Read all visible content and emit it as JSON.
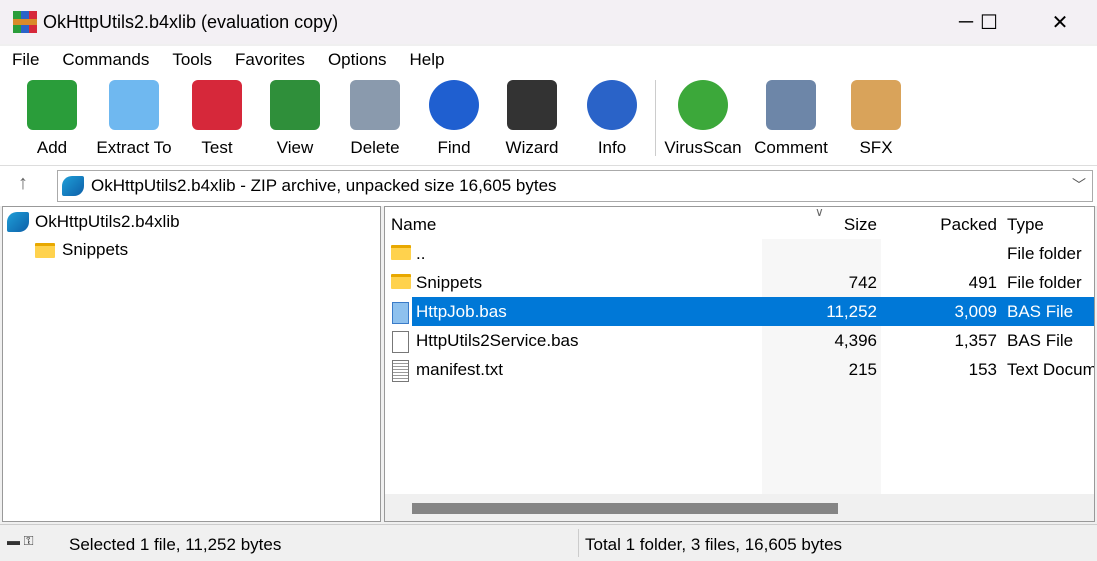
{
  "window": {
    "title": "OkHttpUtils2.b4xlib (evaluation copy)",
    "minimize": "─",
    "maximize": "☐",
    "close": "✕"
  },
  "menu": [
    "File",
    "Commands",
    "Tools",
    "Favorites",
    "Options",
    "Help"
  ],
  "toolbar": [
    {
      "label": "Add",
      "icon": "add-archive-icon",
      "color": "#2a9d3a"
    },
    {
      "label": "Extract To",
      "icon": "extract-folder-icon",
      "color": "#6fb8f0"
    },
    {
      "label": "Test",
      "icon": "test-clipboard-icon",
      "color": "#d6283a"
    },
    {
      "label": "View",
      "icon": "view-book-icon",
      "color": "#2f8f3a"
    },
    {
      "label": "Delete",
      "icon": "trash-icon",
      "color": "#8a9aad"
    },
    {
      "label": "Find",
      "icon": "magnifier-icon",
      "color": "#1f5fd0"
    },
    {
      "label": "Wizard",
      "icon": "magic-wand-icon",
      "color": "#333333"
    },
    {
      "label": "Info",
      "icon": "info-icon",
      "color": "#2a63c8"
    },
    {
      "label": "VirusScan",
      "icon": "virus-scan-icon",
      "color": "#3ca83a"
    },
    {
      "label": "Comment",
      "icon": "comment-icon",
      "color": "#6d86a8"
    },
    {
      "label": "SFX",
      "icon": "sfx-box-icon",
      "color": "#d9a35a"
    }
  ],
  "address": {
    "text": "OkHttpUtils2.b4xlib - ZIP archive, unpacked size 16,605 bytes"
  },
  "tree": {
    "root": "OkHttpUtils2.b4xlib",
    "children": [
      "Snippets"
    ]
  },
  "list": {
    "columns": [
      "Name",
      "Size",
      "Packed",
      "Type"
    ],
    "rows": [
      {
        "name": "..",
        "size": "",
        "packed": "",
        "type": "File folder",
        "icon": "folder"
      },
      {
        "name": "Snippets",
        "size": "742",
        "packed": "491",
        "type": "File folder",
        "icon": "folder"
      },
      {
        "name": "HttpJob.bas",
        "size": "11,252",
        "packed": "3,009",
        "type": "BAS File",
        "icon": "file",
        "selected": true
      },
      {
        "name": "HttpUtils2Service.bas",
        "size": "4,396",
        "packed": "1,357",
        "type": "BAS File",
        "icon": "file"
      },
      {
        "name": "manifest.txt",
        "size": "215",
        "packed": "153",
        "type": "Text Document",
        "icon": "text"
      }
    ]
  },
  "status": {
    "left": "Selected 1 file, 11,252 bytes",
    "right": "Total 1 folder, 3 files, 16,605 bytes"
  }
}
